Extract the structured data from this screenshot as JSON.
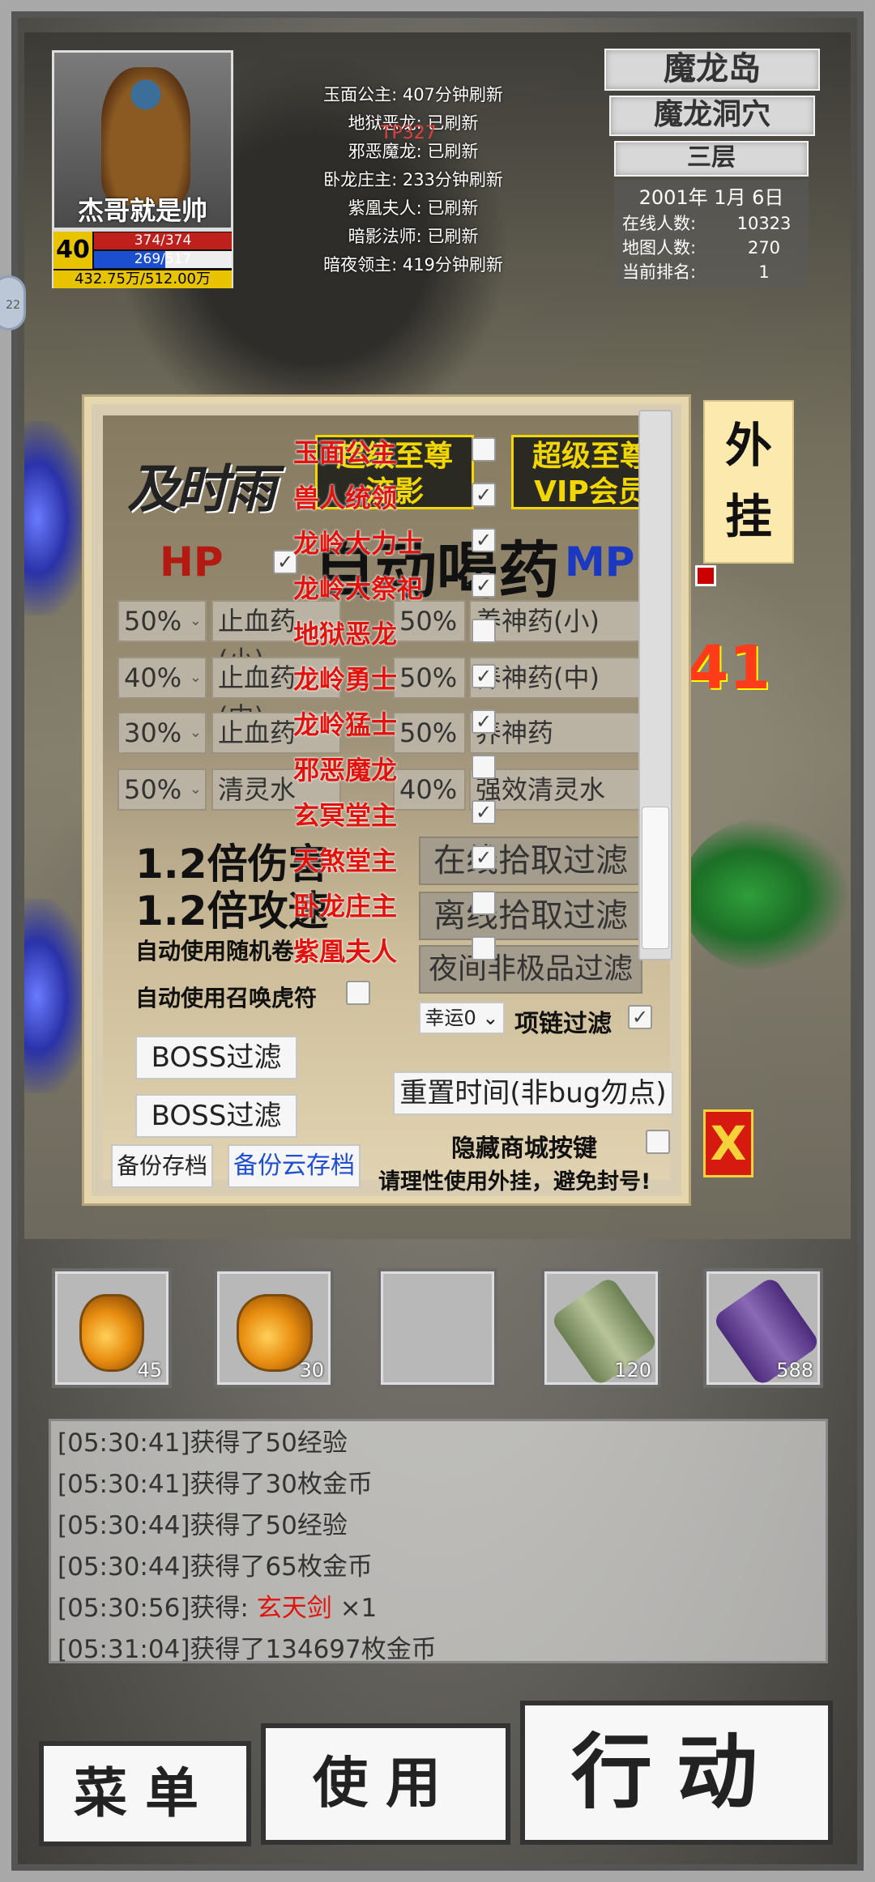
{
  "player": {
    "name": "杰哥就是帅",
    "level": "40",
    "hp": "374/374",
    "mp": "269/517",
    "mp_fraction": 0.52,
    "exp": "432.75万/512.00万"
  },
  "boss_timers": [
    "玉面公主: 407分钟刷新",
    "地狱恶龙: 已刷新",
    "邪恶魔龙: 已刷新",
    "卧龙庄主: 233分钟刷新",
    "紫凰夫人: 已刷新",
    "暗影法师: 已刷新",
    "暗夜领主: 419分钟刷新"
  ],
  "boss_overlay_number": "TP327",
  "side_pill": "22",
  "map": {
    "region": "魔龙岛",
    "area": "魔龙洞穴",
    "floor": "三层",
    "date": "2001年 1月 6日",
    "stats": [
      {
        "label": "在线人数:",
        "value": "10323"
      },
      {
        "label": "地图人数:",
        "value": "270"
      },
      {
        "label": "当前排名:",
        "value": "1"
      }
    ]
  },
  "plugin_dialog": {
    "title": "及时雨",
    "vip_left": [
      "超级至尊",
      "流影"
    ],
    "vip_right": [
      "超级至尊",
      "VIP会员"
    ],
    "hp_label": "HP",
    "mp_label": "MP",
    "auto_drink": "自动喝药",
    "hp_rows": [
      {
        "pct": "50%",
        "item": "止血药(小)"
      },
      {
        "pct": "40%",
        "item": "止血药(中)"
      },
      {
        "pct": "30%",
        "item": "止血药"
      },
      {
        "pct": "50%",
        "item": "清灵水"
      }
    ],
    "mp_rows": [
      {
        "pct": "50%",
        "item": "养神药(小)"
      },
      {
        "pct": "50%",
        "item": "养神药(中)"
      },
      {
        "pct": "50%",
        "item": "养神药"
      },
      {
        "pct": "40%",
        "item": "强效清灵水"
      }
    ],
    "damage_bonus": "1.2倍伤害",
    "attack_bonus": "1.2倍攻速",
    "auto_random": "自动使用随机卷",
    "auto_summon": "自动使用召唤虎符",
    "online_filter": "在线拾取过滤",
    "offline_filter": "离线拾取过滤",
    "night_filter": "夜间非极品过滤",
    "luck_select": "幸运0",
    "necklace_filter": "项链过滤",
    "boss_filter_1": "BOSS过滤",
    "boss_filter_2": "BOSS过滤",
    "reset_time": "重置时间(非bug勿点)",
    "hide_shop": "隐藏商城按键",
    "backup_save": "备份存档",
    "backup_cloud": "备份云存档",
    "hint": "请理性使用外挂，避免封号!"
  },
  "boss_list": [
    {
      "name": "玉面公主",
      "checked": false
    },
    {
      "name": "兽人统领",
      "checked": true
    },
    {
      "name": "龙岭大力士",
      "checked": true
    },
    {
      "name": "龙岭大祭祀",
      "checked": true
    },
    {
      "name": "地狱恶龙",
      "checked": false
    },
    {
      "name": "龙岭勇士",
      "checked": true
    },
    {
      "name": "龙岭猛士",
      "checked": true
    },
    {
      "name": "邪恶魔龙",
      "checked": false
    },
    {
      "name": "玄冥堂主",
      "checked": true
    },
    {
      "name": "天煞堂主",
      "checked": true
    },
    {
      "name": "卧龙庄主",
      "checked": false
    },
    {
      "name": "紫凰夫人",
      "checked": false
    }
  ],
  "plugin_button": "外挂",
  "close_button": "X",
  "damage_number": "41",
  "inventory": [
    {
      "icon": "potion-small-icon",
      "qty": "45"
    },
    {
      "icon": "potion-large-icon",
      "qty": "30"
    },
    {
      "icon": "",
      "qty": ""
    },
    {
      "icon": "scroll-green-icon",
      "qty": "120"
    },
    {
      "icon": "scroll-purple-icon",
      "qty": "588"
    }
  ],
  "log": [
    {
      "text": "[05:30:41]获得了50经验"
    },
    {
      "text": "[05:30:41]获得了30枚金币"
    },
    {
      "text": "[05:30:44]获得了50经验"
    },
    {
      "text": "[05:30:44]获得了65枚金币"
    },
    {
      "prefix": "[05:30:56]获得: ",
      "item": "玄天剑",
      "suffix": " ×1"
    },
    {
      "text": "[05:31:04]获得了134697枚金币"
    }
  ],
  "buttons": {
    "menu": "菜单",
    "use": "使用",
    "action": "行动"
  },
  "colors": {
    "hp": "#c0201c",
    "mp": "#1c4fd0",
    "exp": "#e8c400",
    "boss_red": "#e0140c",
    "vip_gold": "#f1d600"
  }
}
